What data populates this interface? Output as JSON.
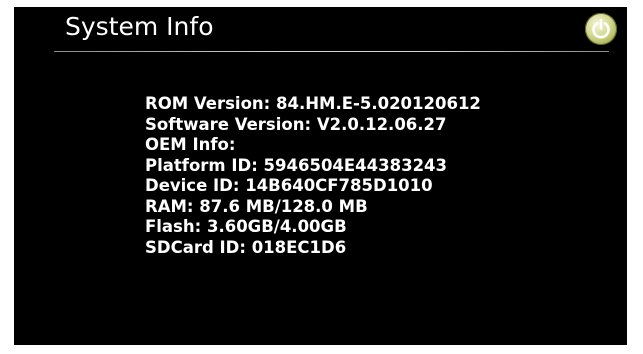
{
  "header": {
    "title": "System Info",
    "power_icon": "power-icon"
  },
  "colors": {
    "background": "#000000",
    "text": "#ffffff",
    "power_button": "#c8cf7a"
  },
  "info": {
    "lines": [
      "ROM Version: 84.HM.E-5.020120612",
      "Software Version: V2.0.12.06.27",
      "OEM Info:",
      "Platform ID: 5946504E44383243",
      "Device ID: 14B640CF785D1010",
      "RAM: 87.6 MB/128.0 MB",
      "Flash: 3.60GB/4.00GB",
      "SDCard ID: 018EC1D6"
    ]
  }
}
